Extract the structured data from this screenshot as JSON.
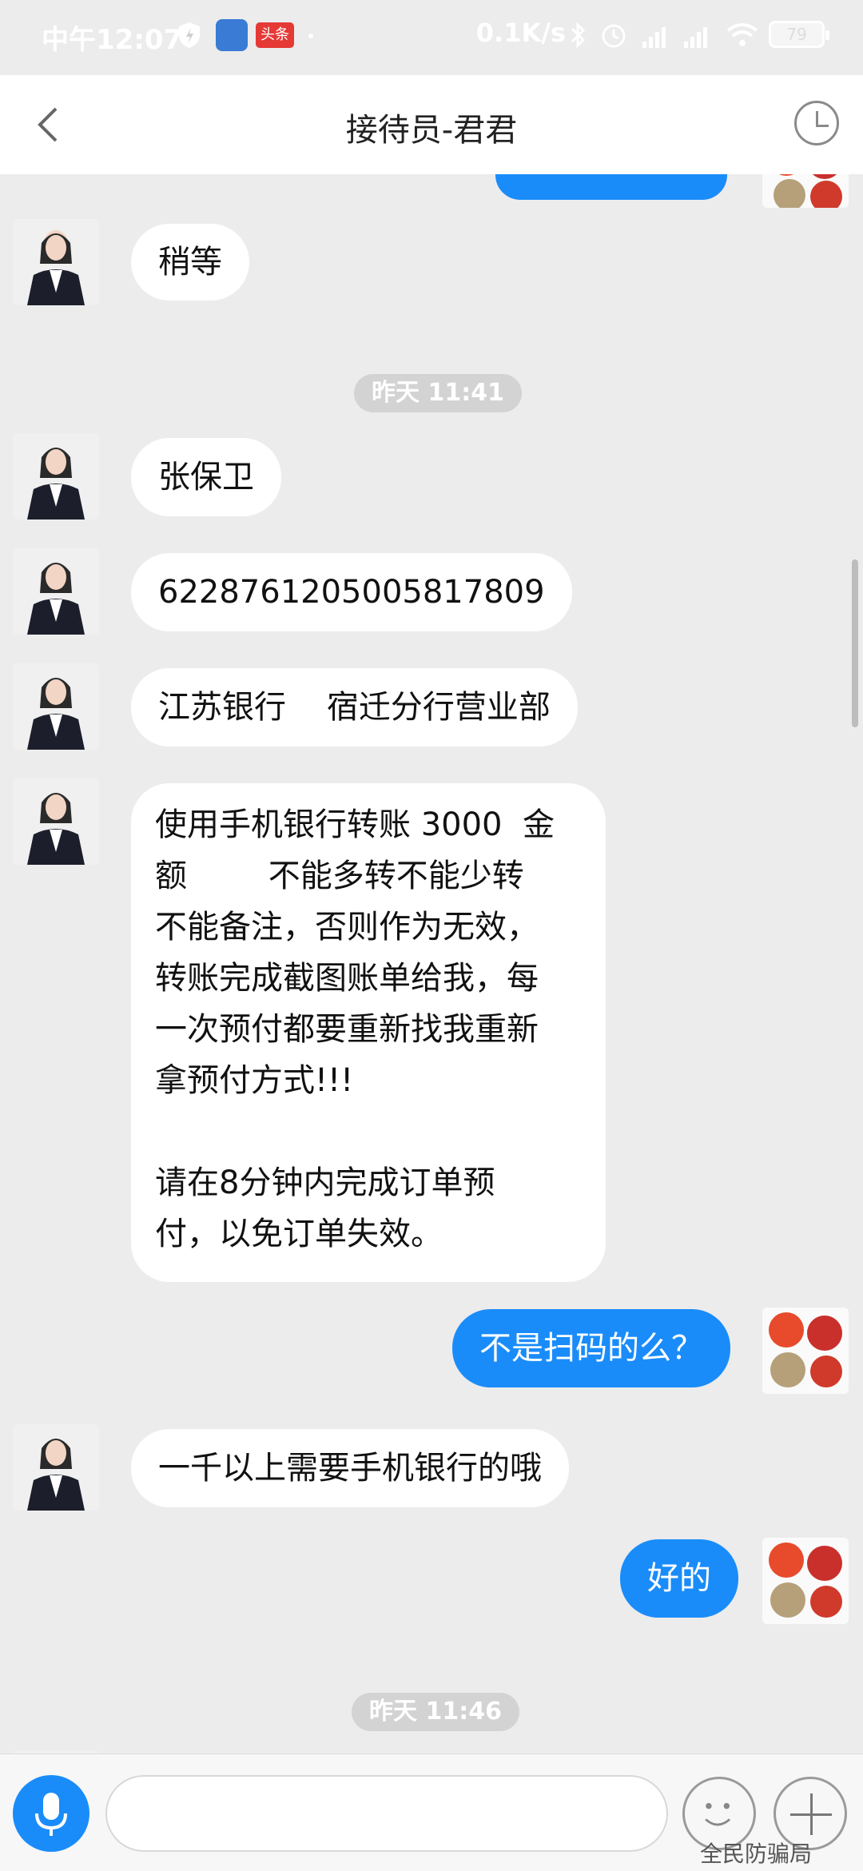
{
  "status_bar": {
    "time": "中午12:07",
    "net_speed": "0.1K/s",
    "battery": "79",
    "app_badge": "头条"
  },
  "header": {
    "title": "接待员-君君"
  },
  "messages": [
    {
      "side": "in",
      "text": "稍等"
    },
    {
      "type": "time",
      "text": "昨天 11:41"
    },
    {
      "side": "in",
      "text": "张保卫"
    },
    {
      "side": "in",
      "text": "6228761205005817809"
    },
    {
      "side": "in",
      "text": "江苏银行    宿迁分行营业部"
    },
    {
      "side": "in",
      "text": "使用手机银行转账 3000  金\n额        不能多转不能少转\n不能备注，否则作为无效，\n转账完成截图账单给我，每\n一次预付都要重新找我重新\n拿预付方式!!!\n\n请在8分钟内完成订单预\n付，以免订单失效。"
    },
    {
      "side": "out",
      "text": "不是扫码的么？"
    },
    {
      "side": "in",
      "text": "一千以上需要手机银行的哦"
    },
    {
      "side": "out",
      "text": "好的"
    },
    {
      "type": "time",
      "text": "昨天 11:46"
    }
  ],
  "input": {
    "placeholder": ""
  },
  "watermark": "全民防骗局",
  "colors": {
    "outgoing_bubble": "#1a8cfa",
    "incoming_bubble": "#ffffff",
    "background": "#ececec"
  }
}
